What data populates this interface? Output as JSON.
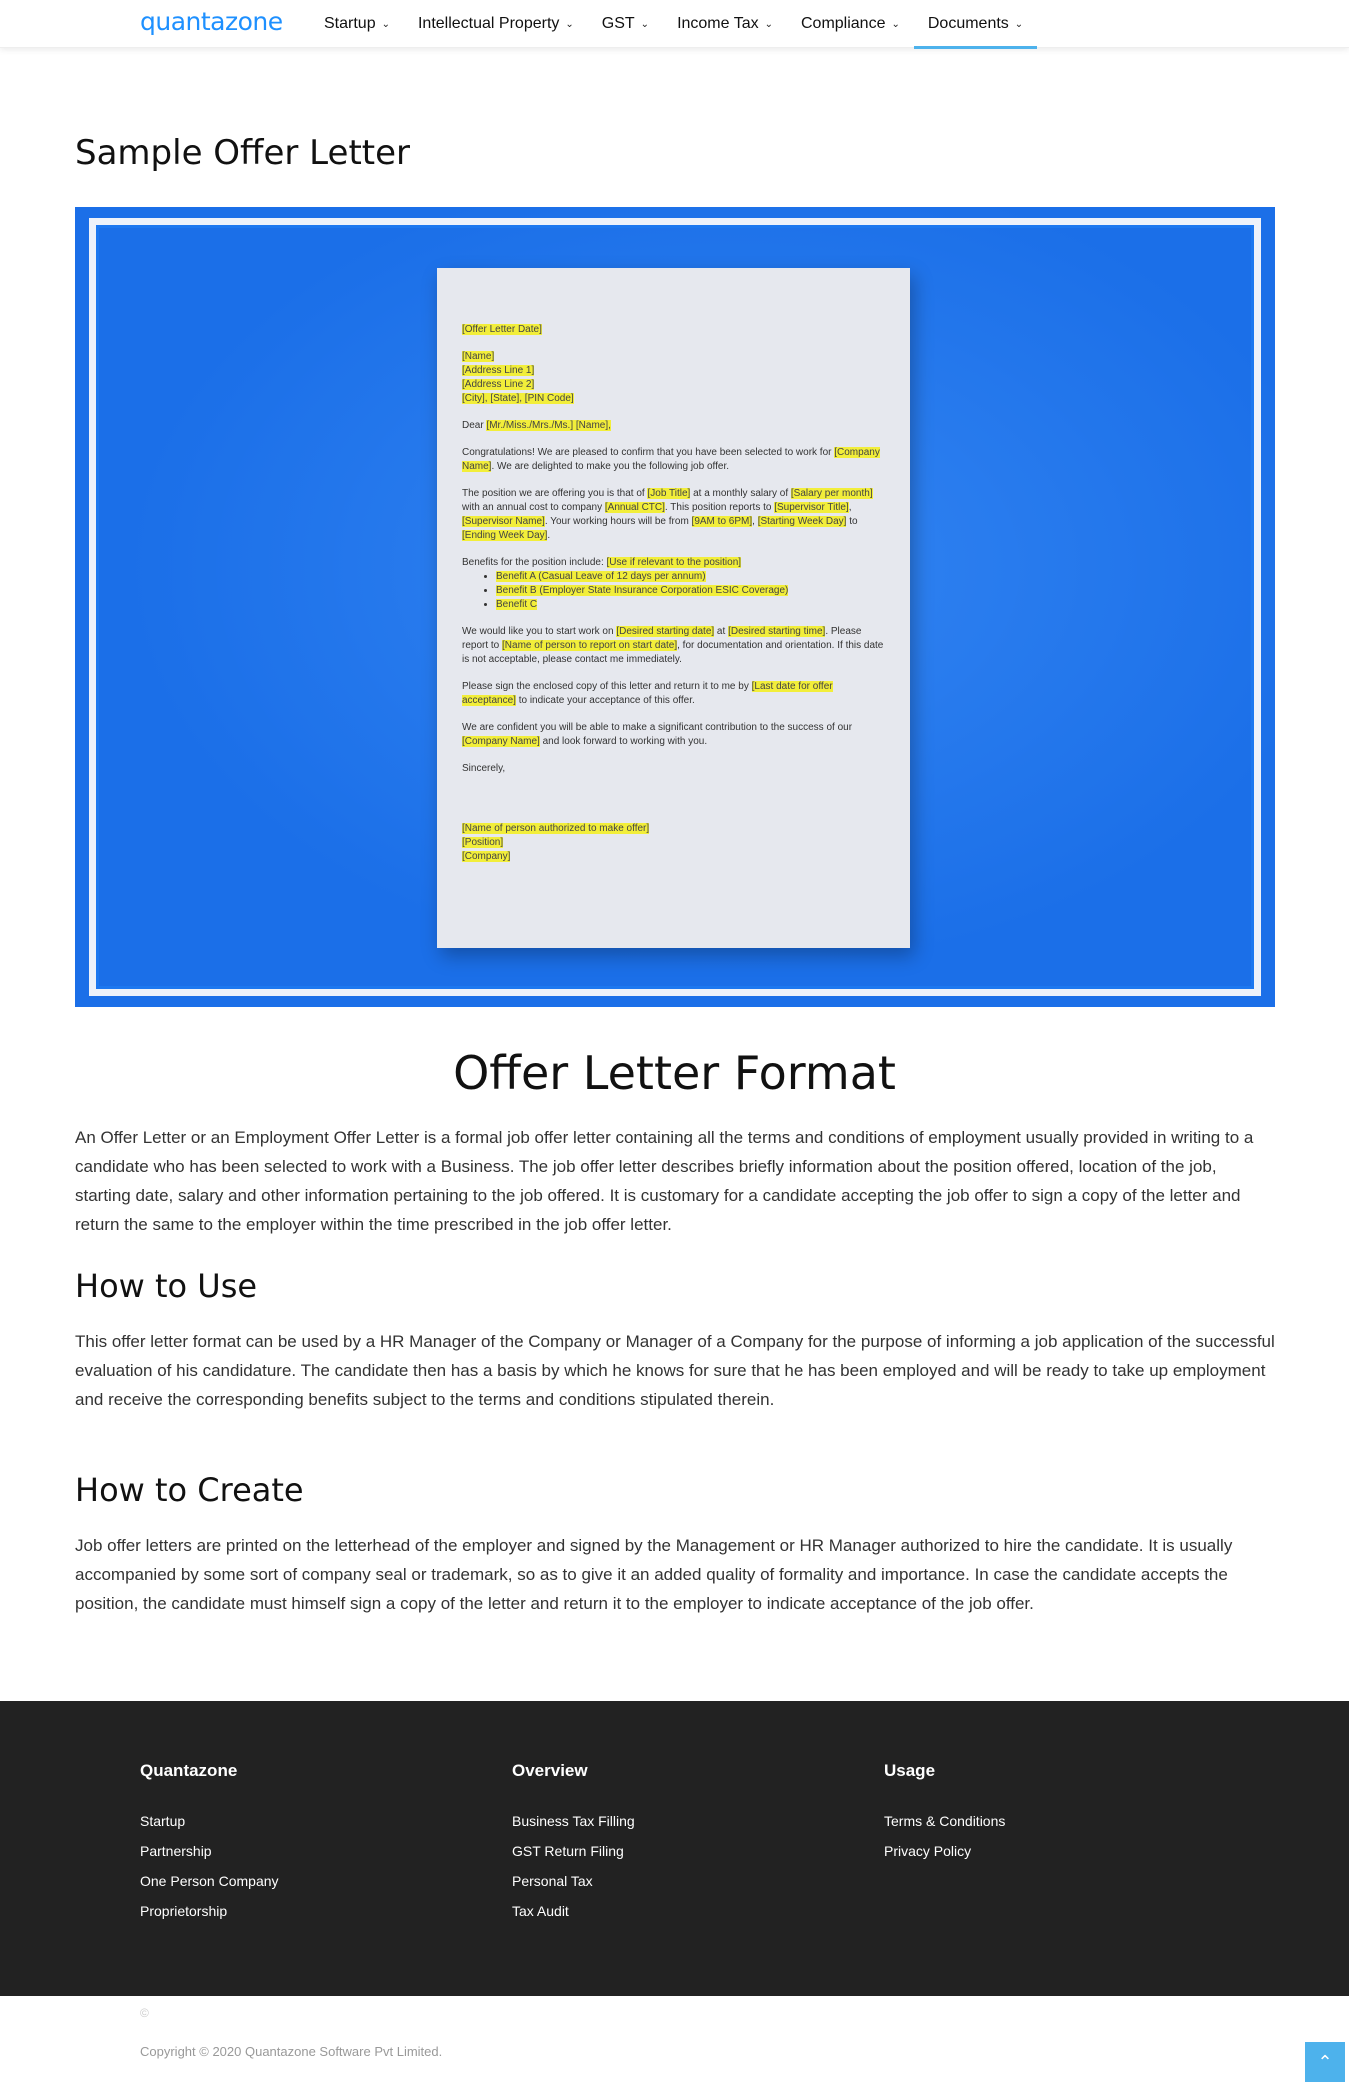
{
  "header": {
    "logo": "quantazone",
    "nav": [
      {
        "label": "Startup",
        "chevron": "⌄"
      },
      {
        "label": "Intellectual Property",
        "chevron": "⌄"
      },
      {
        "label": "GST",
        "chevron": "⌄"
      },
      {
        "label": "Income Tax",
        "chevron": "⌄"
      },
      {
        "label": "Compliance",
        "chevron": "⌄"
      },
      {
        "label": "Documents",
        "chevron": "⌄"
      }
    ]
  },
  "main": {
    "title": "Sample Offer Letter",
    "letter": {
      "date": "[Offer Letter Date]",
      "name": "[Name]",
      "addr1": "[Address Line 1]",
      "addr2": "[Address Line 2]",
      "city": "[City], [State], [PIN Code]",
      "dear_prefix": "Dear ",
      "dear_hl": "[Mr./Miss./Mrs./Ms.] [Name],",
      "congrats_pre": "Congratulations! We are pleased to confirm that you have been selected to work for ",
      "congrats_hl": "[Company Name]",
      "congrats_post": ". We are delighted to make you the following job offer.",
      "position_a": "The position we are offering you is that of ",
      "position_hl1": "[Job Title]",
      "position_b": " at a monthly salary of ",
      "position_hl2": "[Salary per month]",
      "position_c": " with an annual cost to company ",
      "position_hl3": "[Annual CTC]",
      "position_d": ". This position reports to ",
      "position_hl4": "[Supervisor Title]",
      "position_e": ", ",
      "position_hl5": "[Supervisor Name]",
      "position_f": ". Your working hours will be from ",
      "position_hl6": "[9AM to 6PM]",
      "position_g": ", ",
      "position_hl7": "[Starting Week Day]",
      "position_h": " to ",
      "position_hl8": "[Ending Week Day]",
      "position_i": ".",
      "benefits_pre": "Benefits for the position include: ",
      "benefits_hl": "[Use if relevant to the position]",
      "benefit_a": "Benefit A (Casual Leave of 12 days per annum)",
      "benefit_b": "Benefit B (Employer State Insurance Corporation ESIC Coverage)",
      "benefit_c": "Benefit C",
      "start_a": "We would like you to start work on ",
      "start_hl1": "[Desired starting date]",
      "start_b": " at ",
      "start_hl2": "[Desired starting time]",
      "start_c": ". Please report to ",
      "start_hl3": "[Name of person to report on start date]",
      "start_d": ", for documentation and orientation. If this date is not acceptable, please contact me immediately.",
      "sign_a": "Please sign the enclosed copy of this letter and return it to me by ",
      "sign_hl": "[Last date for offer acceptance]",
      "sign_b": " to indicate your acceptance of this offer.",
      "conf_a": "We are confident you will be able to make a significant contribution to the success of our ",
      "conf_hl": "[Company Name]",
      "conf_b": " and look forward to working with you.",
      "sincerely": "Sincerely,",
      "sig1": "[Name of person authorized to make offer]",
      "sig2": "[Position]",
      "sig3": "[Company]"
    },
    "format_heading": "Offer Letter Format",
    "format_text": "An Offer Letter or an Employment Offer Letter is a formal job offer letter containing all the terms and conditions of employment usually provided in writing to a candidate who has been selected to work with a Business. The job offer letter describes briefly information about the position offered, location of the job, starting date, salary and other information pertaining to the job offered. It is customary for a candidate accepting the job offer to sign a copy of the letter and return the same to the employer within the time prescribed in the job offer letter.",
    "use_heading": "How to Use",
    "use_text": "This offer letter format can be used by a HR Manager of the Company or Manager of a Company for the purpose of informing a job application of the successful evaluation of his candidature. The candidate then has a basis by which he knows for sure that he has been employed and will be ready to take up employment and receive the corresponding benefits subject to the terms and conditions stipulated therein.",
    "create_heading": "How to Create",
    "create_text": "Job offer letters are printed on the letterhead of the employer and signed by the Management or HR Manager authorized to hire the candidate. It is usually accompanied by some sort of company seal or trademark, so as to give it an added quality of formality and importance. In case the candidate accepts the position, the candidate must himself sign a copy of the letter and return it to the employer to indicate acceptance of the job offer."
  },
  "footer": {
    "col1": {
      "title": "Quantazone",
      "links": [
        "Startup",
        "Partnership",
        "One Person Company",
        "Proprietorship"
      ]
    },
    "col2": {
      "title": "Overview",
      "links": [
        "Business Tax Filling",
        "GST Return Filing",
        "Personal Tax",
        "Tax Audit"
      ]
    },
    "col3": {
      "title": "Usage",
      "links": [
        "Terms & Conditions",
        "Privacy Policy"
      ]
    },
    "copy_symbol": "©",
    "copyright": "Copyright © 2020 Quantazone Software Pvt Limited.",
    "to_top_icon": "⌃"
  },
  "colors": {
    "accent": "#4db2ec",
    "brand": "#1e90ff",
    "hero_bg": "#1b6fe8",
    "footer_bg": "#222222",
    "highlight": "#f2ee3a"
  }
}
